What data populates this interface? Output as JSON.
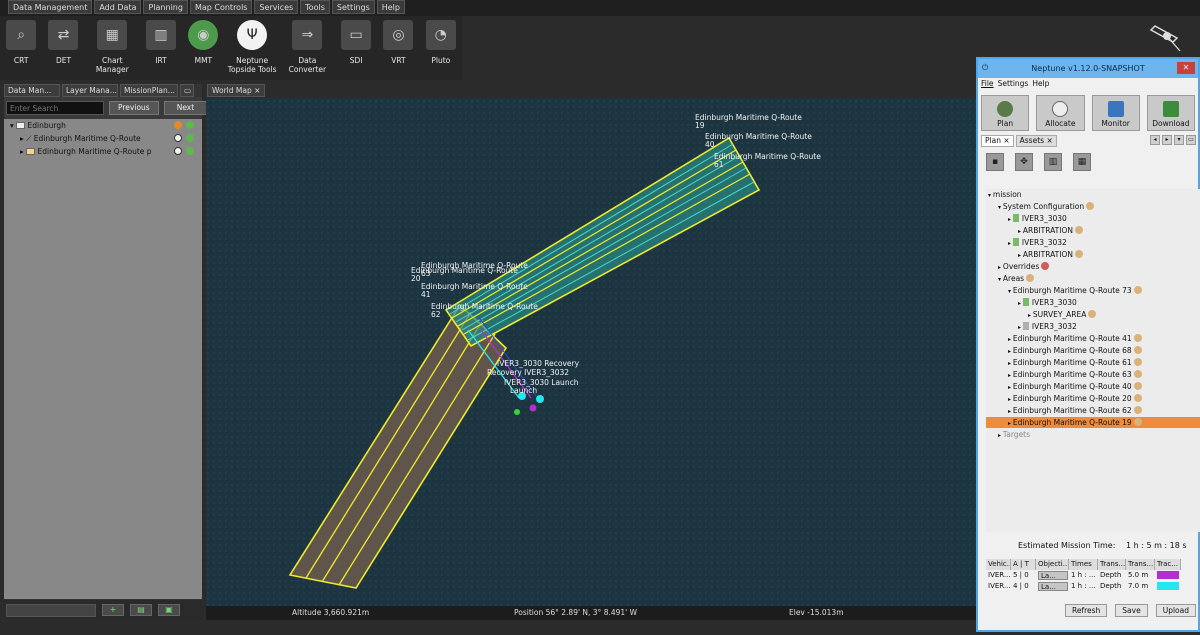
{
  "menu": [
    "Data Management",
    "Add Data",
    "Planning",
    "Map Controls",
    "Services",
    "Tools",
    "Settings",
    "Help"
  ],
  "toolbar": [
    {
      "label": "CRT",
      "icon": "magnifier-icon"
    },
    {
      "label": "DET",
      "icon": "swap-arrows-icon"
    },
    {
      "label": "Chart Manager",
      "icon": "chart-map-icon"
    },
    {
      "label": "IRT",
      "icon": "irt-icon"
    },
    {
      "label": "MMT",
      "icon": "compass-globe-icon"
    },
    {
      "label": "Neptune Topside Tools",
      "icon": "trident-icon"
    },
    {
      "label": "Data Converter",
      "icon": "v3-to-v4-icon"
    },
    {
      "label": "SDI",
      "icon": "sdi-icon"
    },
    {
      "label": "VRT",
      "icon": "vrt-icon"
    },
    {
      "label": "Pluto",
      "icon": "sonar-icon"
    }
  ],
  "left": {
    "tabs": [
      "Data Man...",
      "Layer Mana...",
      "MissionPlan..."
    ],
    "search_placeholder": "Enter Search",
    "prev": "Previous",
    "next": "Next",
    "tree": [
      {
        "label": "Edinburgh",
        "level": 0
      },
      {
        "label": "Edinburgh Maritime Q-Route",
        "level": 1
      },
      {
        "label": "Edinburgh Maritime Q-Route p",
        "level": 1
      }
    ]
  },
  "map": {
    "tab": "World Map",
    "labels": [
      "Edinburgh Maritime Q-Route\n19",
      "Edinburgh Maritime Q-Route\n40",
      "Edinburgh Maritime Q-Route\n61",
      "Edinburgh Maritime Q-Route\n63",
      "Edinburgh Maritime Q-Route\n20",
      "Edinburgh Maritime Q-Route\n41",
      "Edinburgh Maritime Q-Route\n62",
      "IVER3_3030 Recovery",
      "Recovery IVER3_3032",
      "IVER3_3030 Launch",
      "Launch"
    ],
    "status": {
      "altitude": "Altitude 3,660.921m",
      "position": "Position 56° 2.89' N, 3° 8.491' W",
      "elev": "Elev -15.013m"
    }
  },
  "neptune": {
    "title": "Neptune v1.12.0-SNAPSHOT",
    "menu": [
      "File",
      "Settings",
      "Help"
    ],
    "buttons": [
      "Plan",
      "Allocate",
      "Monitor",
      "Download"
    ],
    "tabs": [
      "Plan",
      "Assets"
    ],
    "tree": [
      {
        "label": "mission",
        "indent": 0,
        "status": "none"
      },
      {
        "label": "System Configuration",
        "indent": 1,
        "status": "ok"
      },
      {
        "label": "IVER3_3030",
        "indent": 2,
        "status": "none",
        "vehicle": "green"
      },
      {
        "label": "ARBITRATION",
        "indent": 3,
        "status": "ok"
      },
      {
        "label": "IVER3_3032",
        "indent": 2,
        "status": "none",
        "vehicle": "green"
      },
      {
        "label": "ARBITRATION",
        "indent": 3,
        "status": "ok"
      },
      {
        "label": "Overrides",
        "indent": 1,
        "status": "err"
      },
      {
        "label": "Areas",
        "indent": 1,
        "status": "ok"
      },
      {
        "label": "Edinburgh Maritime Q-Route 73",
        "indent": 2,
        "status": "ok"
      },
      {
        "label": "IVER3_3030",
        "indent": 3,
        "status": "none",
        "vehicle": "green"
      },
      {
        "label": "SURVEY_AREA",
        "indent": 4,
        "status": "ok"
      },
      {
        "label": "IVER3_3032",
        "indent": 3,
        "status": "none",
        "vehicle": "gray"
      },
      {
        "label": "Edinburgh Maritime Q-Route 41",
        "indent": 2,
        "status": "ok"
      },
      {
        "label": "Edinburgh Maritime Q-Route 68",
        "indent": 2,
        "status": "ok"
      },
      {
        "label": "Edinburgh Maritime Q-Route 61",
        "indent": 2,
        "status": "ok"
      },
      {
        "label": "Edinburgh Maritime Q-Route 63",
        "indent": 2,
        "status": "ok"
      },
      {
        "label": "Edinburgh Maritime Q-Route 40",
        "indent": 2,
        "status": "ok"
      },
      {
        "label": "Edinburgh Maritime Q-Route 20",
        "indent": 2,
        "status": "ok"
      },
      {
        "label": "Edinburgh Maritime Q-Route 62",
        "indent": 2,
        "status": "ok"
      },
      {
        "label": "Edinburgh Maritime Q-Route 19",
        "indent": 2,
        "status": "ok",
        "selected": true
      },
      {
        "label": "Targets",
        "indent": 1,
        "status": "none",
        "muted": true
      }
    ],
    "estimated_label": "Estimated Mission Time:",
    "estimated_value": "1 h : 5 m : 18 s",
    "table": {
      "headers": [
        "Vehic...",
        "A | T",
        "Objecti...",
        "Times",
        "Trans...",
        "Trans...",
        "Trac..."
      ],
      "rows": [
        [
          "IVER...",
          "5 | 0",
          "La...",
          "1 h : ...",
          "Depth",
          "5.0 m",
          "#b32fd0"
        ],
        [
          "IVER...",
          "4 | 0",
          "La...",
          "1 h : ...",
          "Depth",
          "7.0 m",
          "#22e6f0"
        ]
      ]
    },
    "footer": [
      "Refresh",
      "Save",
      "Upload"
    ]
  }
}
